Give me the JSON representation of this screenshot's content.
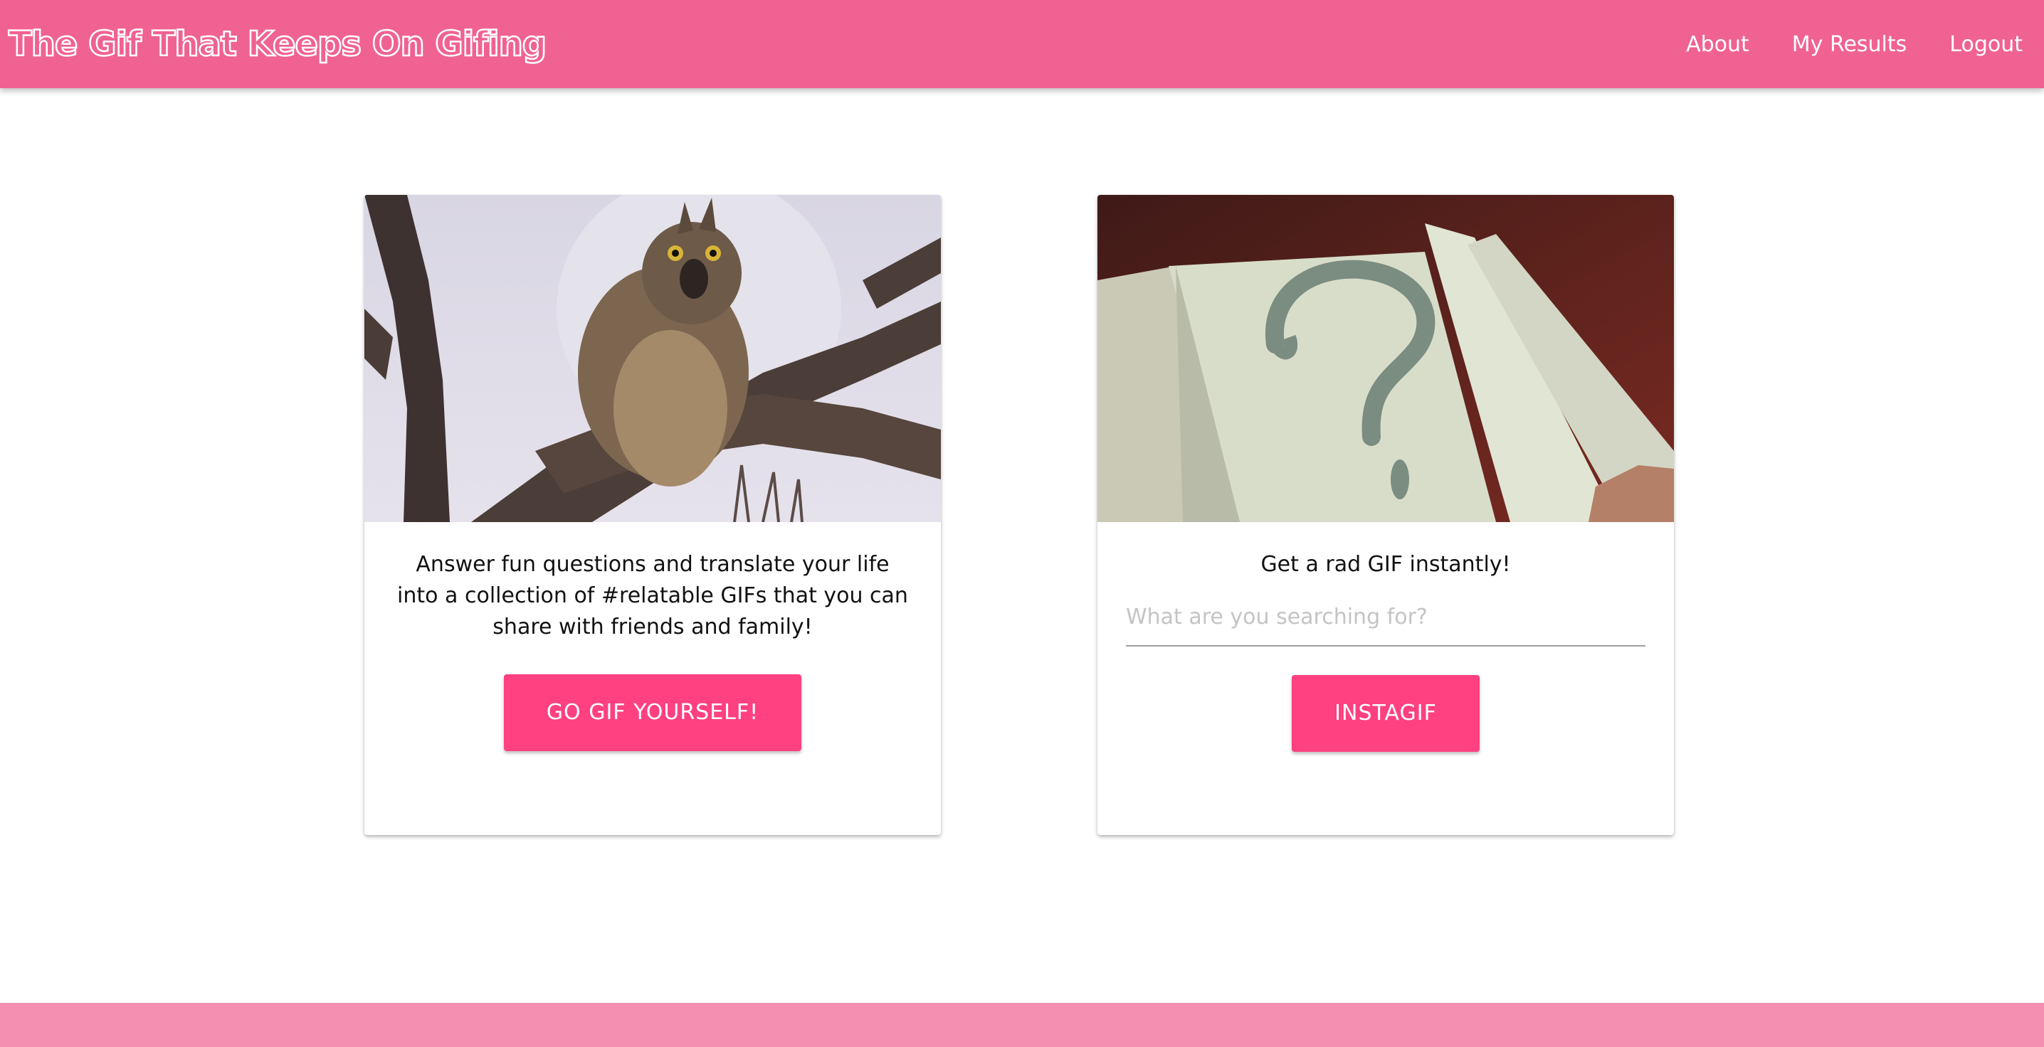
{
  "navbar": {
    "brand": "The Gif That Keeps On Gifing",
    "links": [
      "About",
      "My Results",
      "Logout"
    ]
  },
  "cards": {
    "quiz": {
      "image_subject": "owl-on-branch",
      "text": "Answer fun questions and translate your life into a collection of #relatable GIFs that you can share with friends and family!",
      "button_label": "GO GIF YOURSELF!"
    },
    "instagif": {
      "image_subject": "question-mark-book",
      "text": "Get a rad GIF instantly!",
      "search_placeholder": "What are you searching for?",
      "button_label": "INSTAGIF"
    }
  },
  "colors": {
    "navbar": "#f06292",
    "button": "#ff4081",
    "footer": "#f48fb1"
  }
}
